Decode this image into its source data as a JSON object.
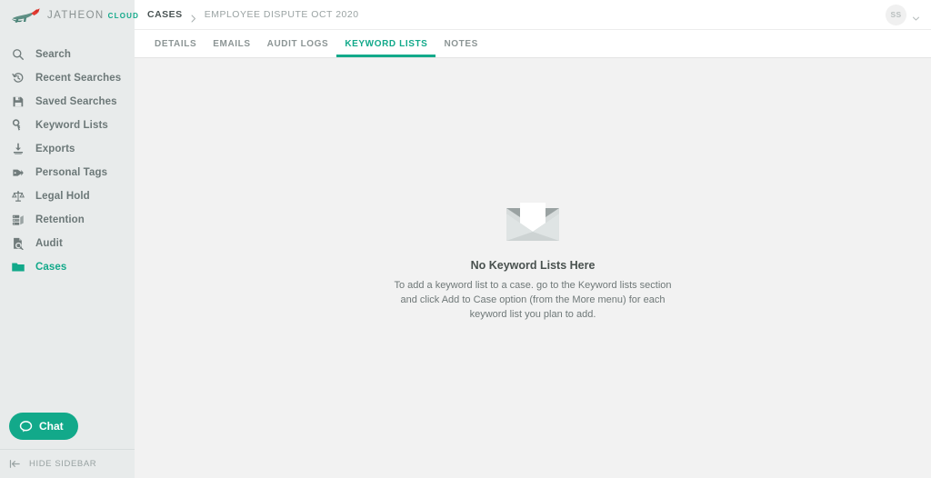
{
  "brand": {
    "name": "JATHEON",
    "suffix": "CLOUD",
    "logo_icon": "jatheon-fox-logo",
    "accent_color": "#12a98a"
  },
  "sidebar": {
    "items": [
      {
        "label": "Search",
        "icon": "search-icon",
        "active": false
      },
      {
        "label": "Recent Searches",
        "icon": "history-clock-icon",
        "active": false
      },
      {
        "label": "Saved Searches",
        "icon": "floppy-disk-icon",
        "active": false
      },
      {
        "label": "Keyword Lists",
        "icon": "key-icon",
        "active": false
      },
      {
        "label": "Exports",
        "icon": "download-icon",
        "active": false
      },
      {
        "label": "Personal Tags",
        "icon": "tag-icon",
        "active": false
      },
      {
        "label": "Legal Hold",
        "icon": "scales-of-justice-icon",
        "active": false
      },
      {
        "label": "Retention",
        "icon": "server-stack-icon",
        "active": false
      },
      {
        "label": "Audit",
        "icon": "document-search-icon",
        "active": false
      },
      {
        "label": "Cases",
        "icon": "folder-icon",
        "active": true
      }
    ],
    "chat_button": {
      "label": "Chat",
      "icon": "speech-bubble-icon"
    },
    "hide_sidebar": {
      "label": "HIDE SIDEBAR",
      "icon": "collapse-left-icon"
    }
  },
  "topbar": {
    "breadcrumb": {
      "root": "CASES",
      "separator_icon": "chevron-right-icon",
      "current": "EMPLOYEE DISPUTE OCT 2020"
    },
    "user": {
      "initials": "SS",
      "chevron_icon": "chevron-down-icon"
    }
  },
  "tabs": [
    {
      "label": "DETAILS",
      "active": false
    },
    {
      "label": "EMAILS",
      "active": false
    },
    {
      "label": "AUDIT LOGS",
      "active": false
    },
    {
      "label": "KEYWORD LISTS",
      "active": true
    },
    {
      "label": "NOTES",
      "active": false
    }
  ],
  "empty_state": {
    "icon": "open-envelope-icon",
    "title": "No Keyword Lists Here",
    "description": "To add a keyword list to a case. go to the Keyword lists section and click Add to Case option (from the More menu) for each keyword list you plan to add."
  }
}
